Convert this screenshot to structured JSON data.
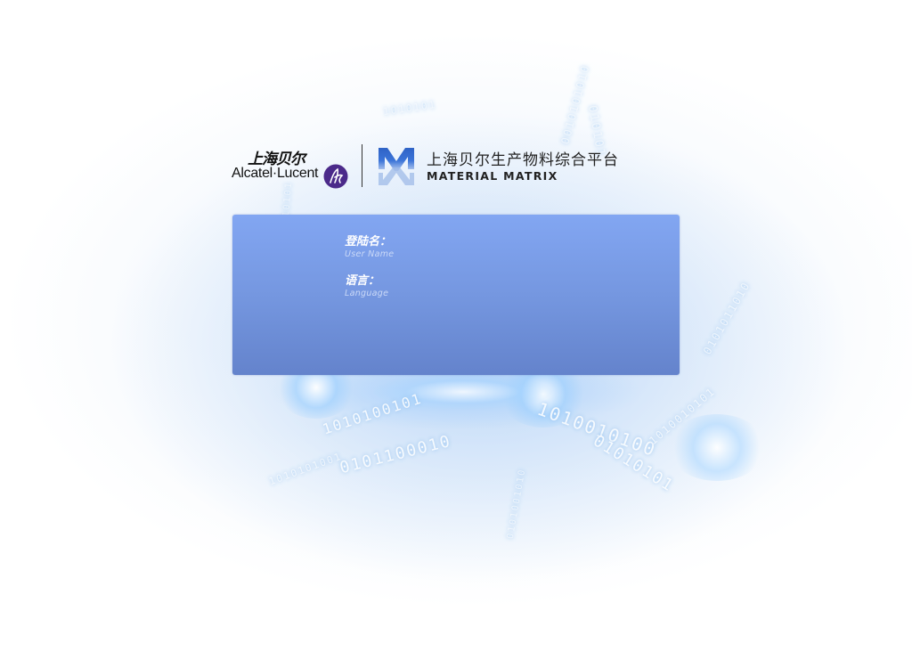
{
  "branding": {
    "alcatel_cn": "上海贝尔",
    "alcatel_en": "Alcatel·Lucent",
    "alcatel_icon": "alcatel-lucent-logo-icon",
    "matrix_icon": "material-matrix-logo-icon",
    "platform_cn": "上海贝尔生产物料综合平台",
    "platform_en": "MATERIAL MATRIX"
  },
  "login": {
    "username_label": "登陆名：",
    "username_sublabel": "User Name",
    "username_value": "",
    "language_label": "语言：",
    "language_sublabel": "Language",
    "language_value": ""
  },
  "background": {
    "binary_strings": [
      "1010100101",
      "0101100010",
      "1010101001",
      "1010010100",
      "01010101",
      "1010010101",
      "0101001010",
      "0010101010",
      "0101011010",
      "1010101",
      "010101",
      "01010101"
    ]
  },
  "colors": {
    "panel_top": "#82a6f2",
    "panel_bottom": "#6483cc",
    "alcatel_purple": "#4b2a8a",
    "matrix_blue": "#2f63c6"
  }
}
